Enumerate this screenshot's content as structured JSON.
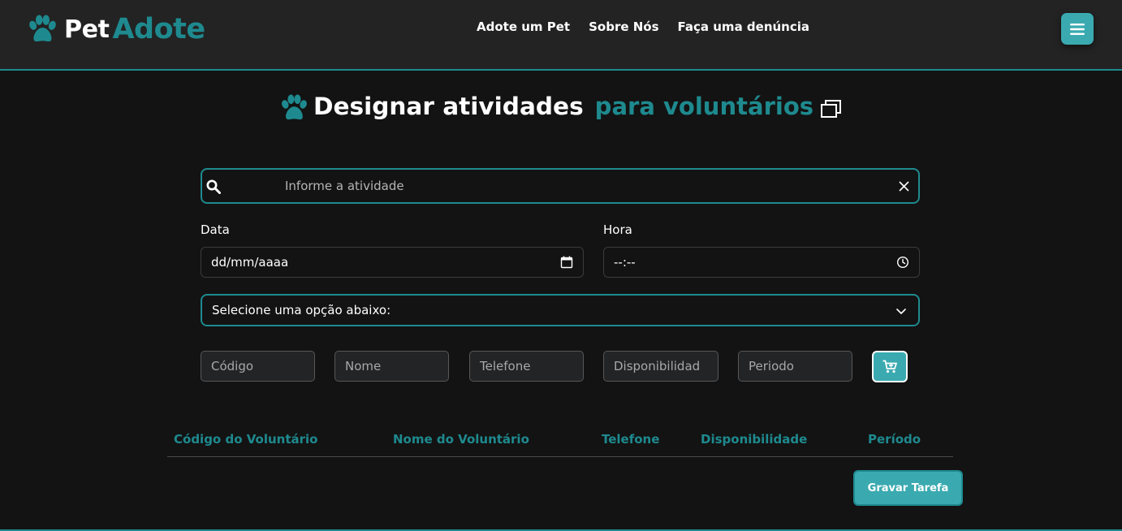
{
  "header": {
    "logo_word1": "Pet",
    "logo_word2": "Adote",
    "nav": [
      "Adote um Pet",
      "Sobre Nós",
      "Faça uma denúncia"
    ],
    "menu_icon": "hamburger-icon"
  },
  "title": {
    "part1": "Designar atividades",
    "part2": "para voluntários"
  },
  "search": {
    "placeholder": "Informe a atividade"
  },
  "form": {
    "date_label": "Data",
    "date_value": "dd/mm/aaaa",
    "time_label": "Hora",
    "time_value": "--:--",
    "select_value": "Selecione uma opção abaixo:"
  },
  "volunteer_inputs": [
    "Código",
    "Nome",
    "Telefone",
    "Disponibilidad",
    "Periodo"
  ],
  "table": {
    "headers": [
      "Código do Voluntário",
      "Nome do Voluntário",
      "Telefone",
      "Disponibilidade",
      "Período"
    ],
    "rows": []
  },
  "save_button": "Gravar Tarefa",
  "colors": {
    "background": "#131313",
    "header_bg": "#232323",
    "accent": "#1e8a8f",
    "button": "#3aaab0"
  }
}
